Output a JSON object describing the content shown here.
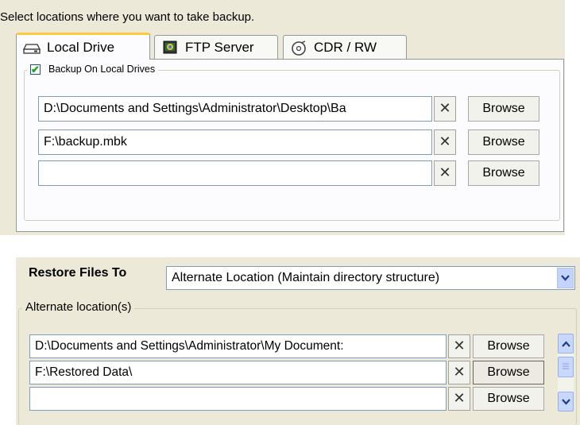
{
  "backup": {
    "prompt": "Select locations where you want to take backup.",
    "tabs": [
      {
        "label": "Local Drive",
        "icon": "hard-drive-icon",
        "active": true
      },
      {
        "label": "FTP Server",
        "icon": "ftp-server-icon",
        "active": false
      },
      {
        "label": "CDR / RW",
        "icon": "cd-burn-icon",
        "active": false
      }
    ],
    "group_label": "Backup On Local Drives",
    "checkbox_checked": true,
    "rows": [
      {
        "path": "D:\\Documents and Settings\\Administrator\\Desktop\\Ba",
        "remove": "✕",
        "browse": "Browse"
      },
      {
        "path": "F:\\backup.mbk",
        "remove": "✕",
        "browse": "Browse"
      },
      {
        "path": "",
        "remove": "✕",
        "browse": "Browse"
      }
    ]
  },
  "restore": {
    "label": "Restore Files To",
    "selected_option": "Alternate Location (Maintain directory structure)",
    "group_label": "Alternate location(s)",
    "rows": [
      {
        "path": "D:\\Documents and Settings\\Administrator\\My Document:",
        "remove": "✕",
        "browse": "Browse"
      },
      {
        "path": "F:\\Restored Data\\",
        "remove": "✕",
        "browse": "Browse"
      },
      {
        "path": "",
        "remove": "✕",
        "browse": "Browse"
      }
    ]
  }
}
